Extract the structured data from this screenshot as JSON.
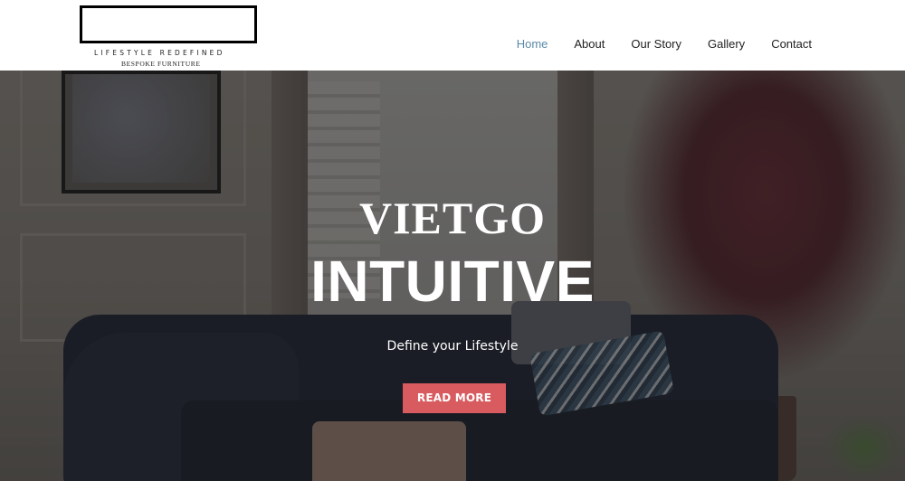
{
  "header": {
    "logo": {
      "tagline": "LIFESTYLE REDEFINED",
      "subtitle": "BESPOKE FURNITURE"
    },
    "nav": [
      {
        "label": "Home",
        "active": true
      },
      {
        "label": "About",
        "active": false
      },
      {
        "label": "Our Story",
        "active": false
      },
      {
        "label": "Gallery",
        "active": false
      },
      {
        "label": "Contact",
        "active": false
      }
    ]
  },
  "hero": {
    "title": "VIETGO",
    "headline": "INTUITIVE",
    "subtitle": "Define your Lifestyle",
    "cta_label": "READ MORE",
    "background": "living-room-sofa-photo"
  },
  "colors": {
    "nav_active": "#5a8aa8",
    "nav_text": "#222222",
    "cta_background": "#d75b5f",
    "hero_text": "#ffffff"
  }
}
